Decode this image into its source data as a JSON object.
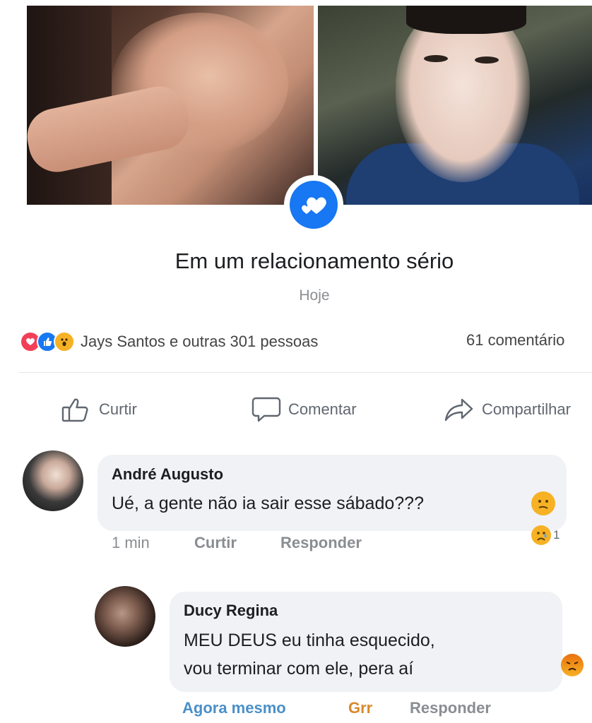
{
  "post": {
    "status_title": "Em um relacionamento sério",
    "date": "Hoje",
    "reactions_summary": "Jays Santos e outras 301 pessoas",
    "comments_count": "61 comentário",
    "reaction_icons": [
      "heart-icon",
      "like-icon",
      "wow-icon"
    ]
  },
  "actions": {
    "like": "Curtir",
    "comment": "Comentar",
    "share": "Compartilhar"
  },
  "comments": [
    {
      "author": "André Augusto",
      "text": "Ué, a gente não ia sair esse sábado???",
      "time": "1 min",
      "like": "Curtir",
      "reply": "Responder",
      "reaction_count": "1"
    },
    {
      "author": "Ducy Regina",
      "text_line1": "MEU DEUS eu tinha esquecido,",
      "text_line2": "vou terminar com ele, pera aí",
      "time": "Agora mesmo",
      "reaction": "Grr",
      "reply": "Responder"
    }
  ],
  "colors": {
    "facebook_blue": "#1877f2",
    "angry_orange": "#e9710f",
    "comment_bubble": "#f0f2f5"
  }
}
